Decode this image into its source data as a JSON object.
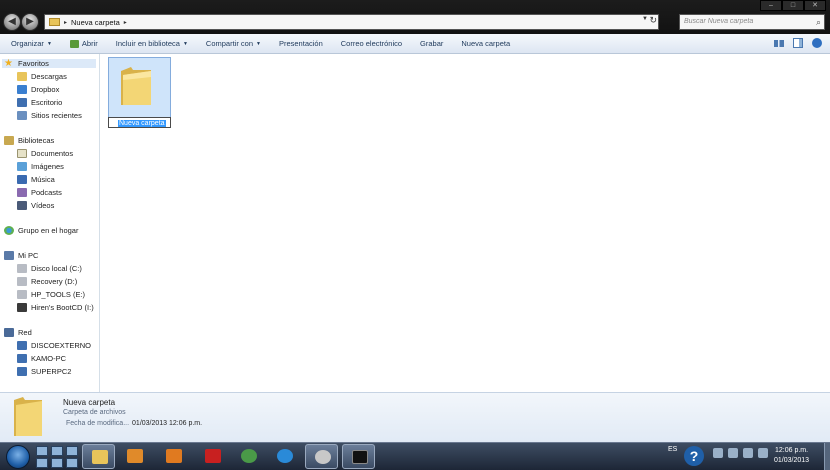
{
  "window": {
    "controls": [
      "minimize",
      "maximize",
      "close"
    ]
  },
  "address_bar": {
    "crumb": "Nueva carpeta",
    "separator_glyph": "▸",
    "dropdown_glyph": "▼",
    "refresh_glyph": "↻"
  },
  "search": {
    "placeholder": "Buscar Nueva carpeta",
    "icon": "magnifier-icon"
  },
  "toolbar": {
    "organize": "Organizar",
    "open": "Abrir",
    "include_library": "Incluir en biblioteca",
    "share": "Compartir con",
    "slideshow": "Presentación",
    "email": "Correo electrónico",
    "burn": "Grabar",
    "new_folder": "Nueva carpeta",
    "arrow_glyph": "▼"
  },
  "nav": {
    "favorites": {
      "label": "Favoritos",
      "items": [
        "Descargas",
        "Dropbox",
        "Escritorio",
        "Sitios recientes"
      ]
    },
    "libraries": {
      "label": "Bibliotecas",
      "items": [
        "Documentos",
        "Imágenes",
        "Música",
        "Podcasts",
        "Vídeos"
      ]
    },
    "homegroup": {
      "label": "Grupo en el hogar"
    },
    "computer": {
      "label": "Mi PC",
      "items": [
        "Disco local (C:)",
        "Recovery (D:)",
        "HP_TOOLS (E:)",
        "Hiren's BootCD (I:)"
      ]
    },
    "network": {
      "label": "Red",
      "items": [
        "DISCOEXTERNO",
        "KAMO-PC",
        "SUPERPC2"
      ]
    }
  },
  "content": {
    "folder_name": "Nueva carpeta"
  },
  "details": {
    "name": "Nueva carpeta",
    "type": "Carpeta de archivos",
    "modified_label": "Fecha de modifica...",
    "modified_value": "01/03/2013 12:06 p.m."
  },
  "taskbar": {
    "language": "ES",
    "help_glyph": "?",
    "time": "12:06 p.m.",
    "date": "01/03/2013"
  },
  "colors": {
    "selection": "#3399ff",
    "folder": "#f0cf6a",
    "toolbar_text": "#1e395b"
  }
}
